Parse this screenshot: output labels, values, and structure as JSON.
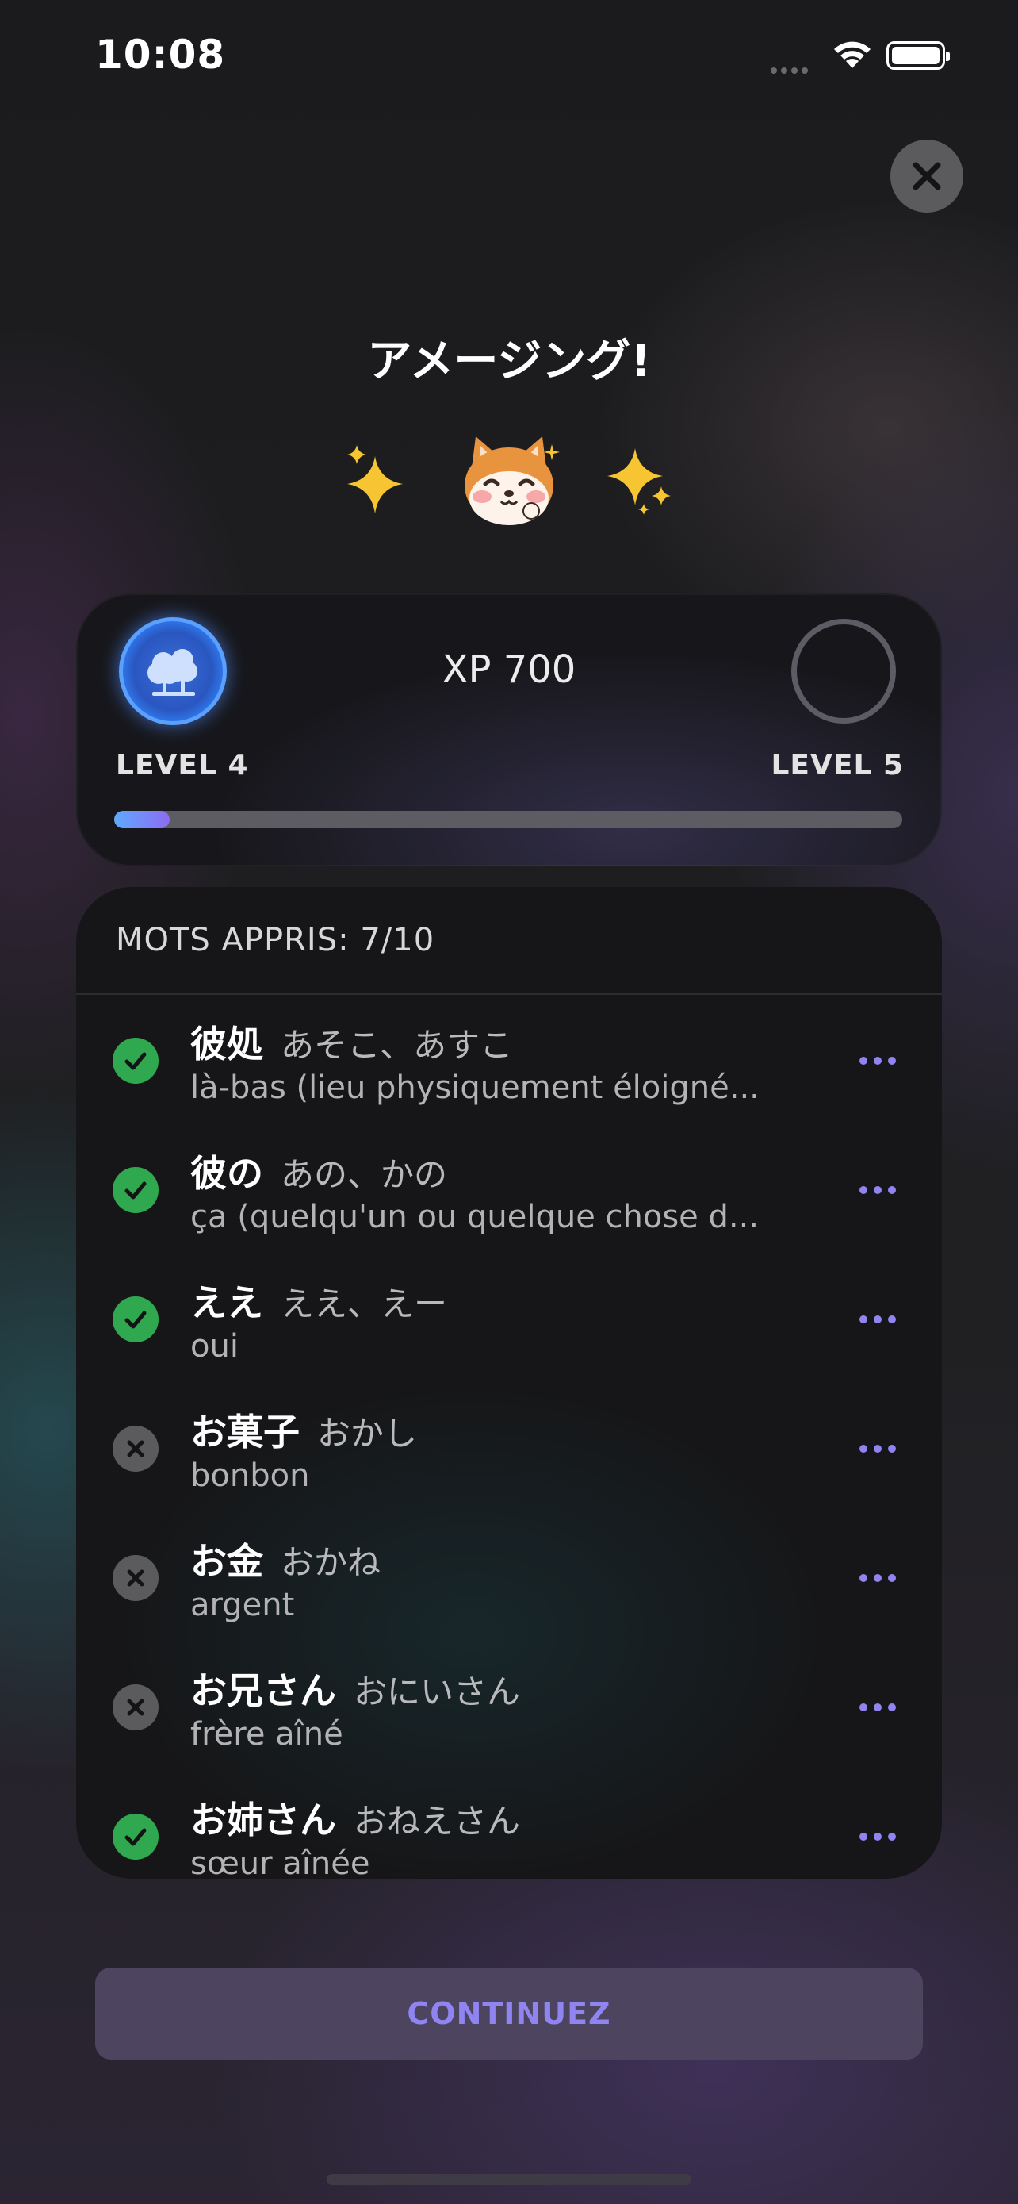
{
  "status_bar": {
    "time": "10:08"
  },
  "header": {
    "title": "アメージング!"
  },
  "mascot": {
    "left_icon": "sparkles-icon",
    "center_icon": "shiba-dog-icon",
    "right_icon": "sparkles-icon"
  },
  "xp_card": {
    "xp_label": "XP 700",
    "current_level": "LEVEL 4",
    "next_level": "LEVEL 5",
    "progress_fraction": 0.07,
    "current_badge_icon": "trees-icon"
  },
  "words": {
    "header": "MOTS APPRIS: 7/10",
    "items": [
      {
        "kanji": "彼処",
        "reading": "あそこ、あすこ",
        "meaning": "là-bas (lieu physiquement éloigné...",
        "status": "learned"
      },
      {
        "kanji": "彼の",
        "reading": "あの、かの",
        "meaning": "ça (quelqu'un ou quelque chose d...",
        "status": "learned"
      },
      {
        "kanji": "ええ",
        "reading": "ええ、えー",
        "meaning": "oui",
        "status": "learned"
      },
      {
        "kanji": "お菓子",
        "reading": "おかし",
        "meaning": "bonbon",
        "status": "missed"
      },
      {
        "kanji": "お金",
        "reading": "おかね",
        "meaning": "argent",
        "status": "missed"
      },
      {
        "kanji": "お兄さん",
        "reading": "おにいさん",
        "meaning": "frère aîné",
        "status": "missed"
      },
      {
        "kanji": "お姉さん",
        "reading": "おねえさん",
        "meaning": "sœur aînée",
        "status": "learned"
      }
    ]
  },
  "footer": {
    "continue_label": "CONTINUEZ"
  },
  "colors": {
    "accent": "#8f84f0",
    "learned": "#2fa84f",
    "missed": "#5b5b5e",
    "level_badge": "#3a6fd8"
  }
}
